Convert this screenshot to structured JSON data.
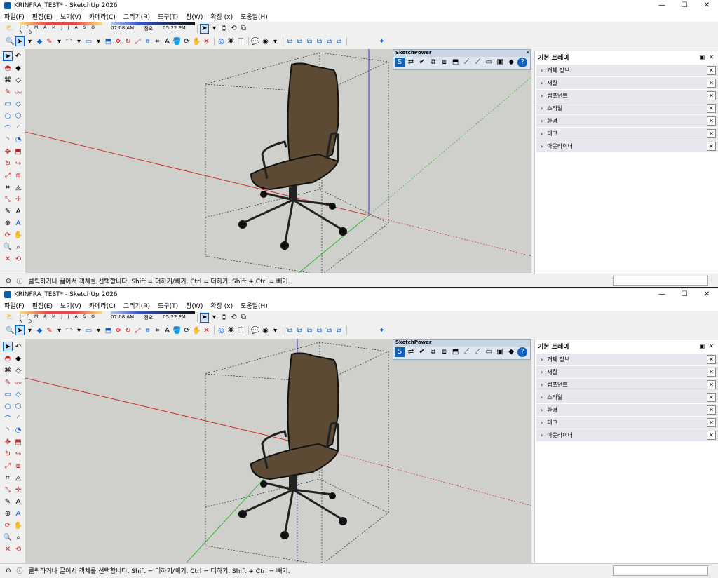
{
  "window": {
    "title": "KRINFRA_TEST* - SketchUp 2026",
    "controls": [
      "—",
      "☐",
      "✕"
    ]
  },
  "menu": [
    "파일(F)",
    "편집(E)",
    "보기(V)",
    "카메라(C)",
    "그리기(R)",
    "도구(T)",
    "창(W)",
    "확장 (x)",
    "도움말(H)"
  ],
  "shadow": {
    "months": "J F M A M J J A S O N D",
    "time_start": "07:08 AM",
    "time_mid": "정오",
    "time_end": "05:22 PM"
  },
  "sketchpower": {
    "title": "SketchPower",
    "close": "✕"
  },
  "tray": {
    "title": "기본 트레이",
    "items": [
      "개체 정보",
      "재질",
      "컴포넌트",
      "스타일",
      "환경",
      "태그",
      "아웃라이너"
    ]
  },
  "status": {
    "message": "클릭하거나 끌어서 객체를 선택합니다. Shift = 더하기/빼기. Ctrl = 더하기. Shift + Ctrl = 빼기."
  },
  "colors": {
    "axis_red": "#d01010",
    "axis_green": "#10b010",
    "axis_blue": "#1010d0",
    "chair_brown": "#5c4a35",
    "viewport_bg": "#cfcfcb"
  }
}
